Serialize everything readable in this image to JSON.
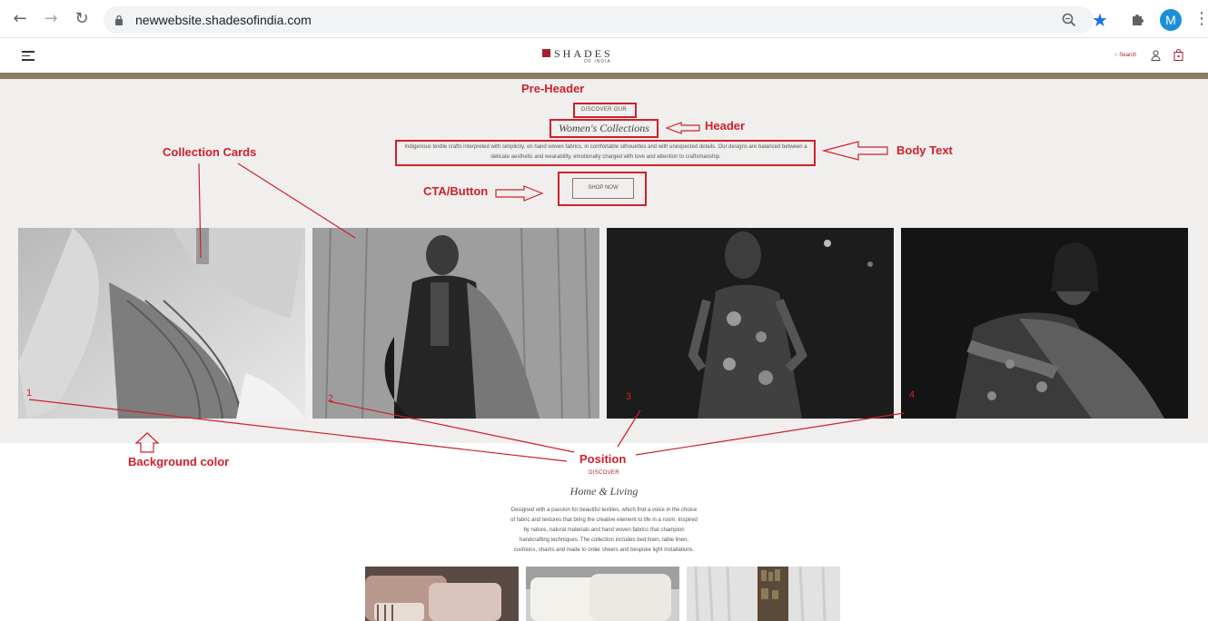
{
  "browser": {
    "url": "newwebsite.shadesofindia.com",
    "profile_initial": "M",
    "icons": [
      "back-arrow",
      "forward-arrow",
      "reload",
      "lock",
      "zoom",
      "bookmark-star",
      "extensions-puzzle",
      "more-vertical"
    ]
  },
  "site": {
    "logo_text": "SHADES",
    "logo_sub": "OF INDIA",
    "search_label": "Search",
    "brand_color": "#a31f2b",
    "rule_color": "#8a7a62"
  },
  "collection": {
    "preheader": "DISCOVER OUR",
    "title": "Women's Collections",
    "body": "Indigenous textile crafts interpreted with simplicity, on hand woven fabrics, in comfortable silhouettes and with unexpected details. Our designs are balanced between a delicate aesthetic and wearability, emotionally charged with love and attention to craftsmanship.",
    "cta_label": "SHOP NOW",
    "background_color": "#f0efee"
  },
  "home_living": {
    "preheader": "DISCOVER",
    "title": "Home & Living",
    "body": "Designed with a passion for beautiful textiles, which find a voice in the choice of fabric and textures that bring the creative element to life in a room. Inspired by nature, natural materials and hand woven fabrics that champion handcrafting techniques. The collection includes bed linen, table linen, cushions, shams and made to order sheers and bespoke light installations."
  },
  "annotations": {
    "pre_header": "Pre-Header",
    "header": "Header",
    "body_text": "Body Text",
    "cta": "CTA/Button",
    "collection_cards": "Collection Cards",
    "position": "Position",
    "background_color": "Background color",
    "numbers": [
      "1",
      "2",
      "3",
      "4"
    ],
    "color": "#d0202a"
  }
}
